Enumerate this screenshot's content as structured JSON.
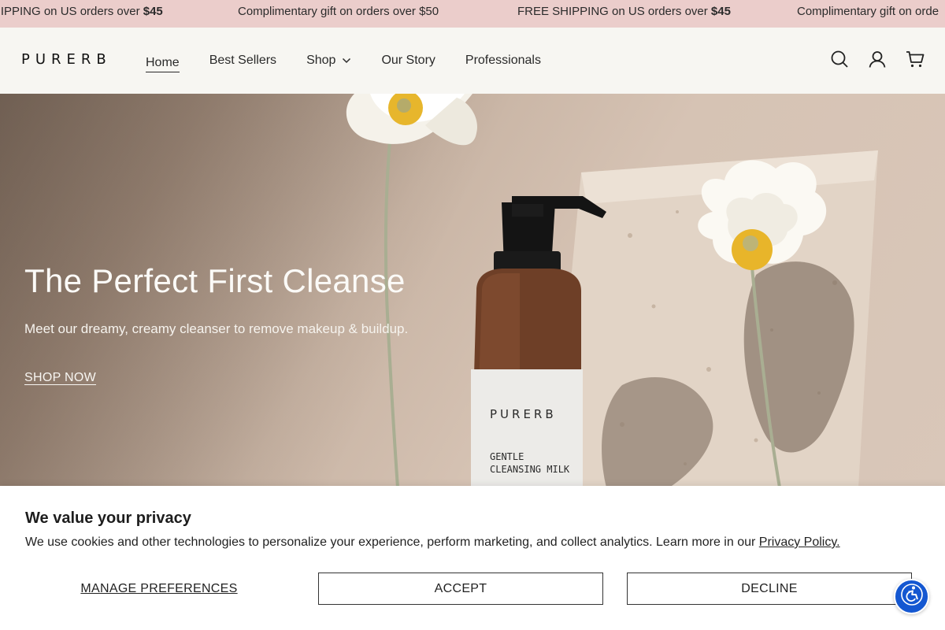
{
  "announcement": {
    "messages": [
      {
        "text": "HIPPING on US orders over ",
        "bold": "$45"
      },
      {
        "text": "Complimentary gift on orders over $50",
        "bold": ""
      },
      {
        "text": "FREE SHIPPING on US orders over ",
        "bold": "$45"
      },
      {
        "text": "Complimentary gift on orde",
        "bold": ""
      }
    ],
    "background": "#ebcdcb"
  },
  "header": {
    "logo": "PURERB",
    "nav": [
      {
        "label": "Home",
        "active": true
      },
      {
        "label": "Best Sellers"
      },
      {
        "label": "Shop",
        "has_dropdown": true
      },
      {
        "label": "Our Story"
      },
      {
        "label": "Professionals"
      }
    ],
    "icons": [
      "search-icon",
      "account-icon",
      "cart-icon"
    ]
  },
  "hero": {
    "title": "The Perfect First Cleanse",
    "subtitle": "Meet our dreamy, creamy cleanser to remove makeup & buildup.",
    "cta": "SHOP NOW",
    "product_brand": "PURERB",
    "product_line1": "GENTLE",
    "product_line2": "CLEANSING MILK"
  },
  "cookie": {
    "title": "We value your privacy",
    "text": "We use cookies and other technologies to personalize your experience, perform marketing, and collect analytics. Learn more in our ",
    "link": "Privacy Policy.",
    "manage_label": "MANAGE PREFERENCES",
    "accept_label": "ACCEPT",
    "decline_label": "DECLINE"
  },
  "accessibility": {
    "icon": "accessibility-icon",
    "color": "#1457d1"
  }
}
